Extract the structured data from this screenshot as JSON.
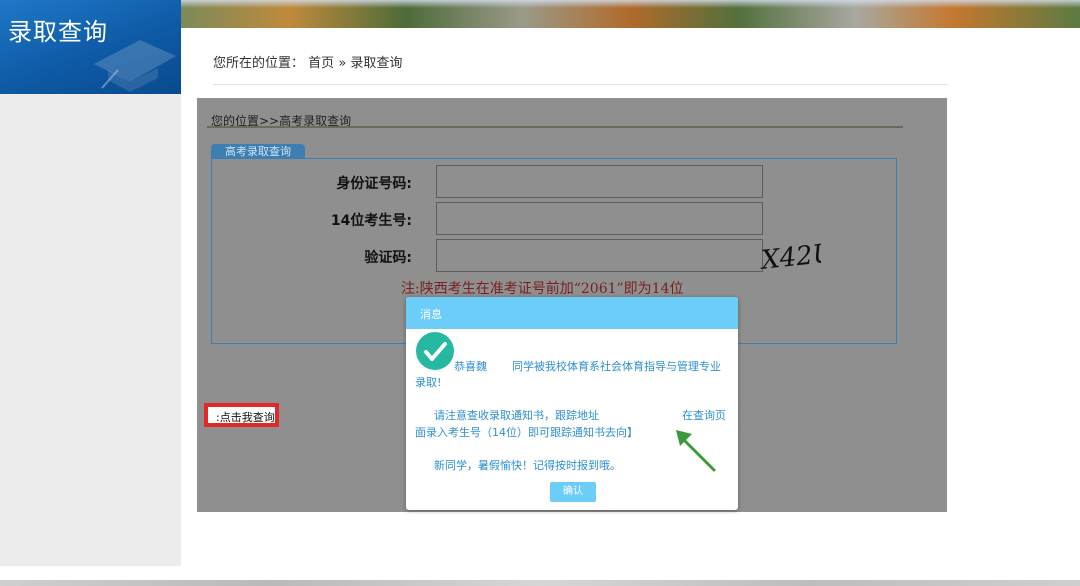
{
  "sidebar": {
    "title": "录取查询"
  },
  "location": {
    "prefix": "您所在的位置：",
    "home": "首页",
    "sep": " » ",
    "current": "录取查询"
  },
  "main": {
    "breadcrumb": "您的位置>>高考录取查询",
    "tab_label": "高考录取查询",
    "form": {
      "id_label": "身份证号码:",
      "exam_label": "14位考生号:",
      "captcha_label": "验证码:",
      "captcha_text": "X42U",
      "note": "注:陕西考生在准考证号前加“2061”即为14位"
    }
  },
  "dialog": {
    "title": "消息",
    "congrats_a": "恭喜魏",
    "congrats_b": "同学被我校体育系社会体育指导与管理专业",
    "congrats_c": "录取!",
    "notice_a": "请注意查收录取通知书，跟踪地址",
    "notice_link": ":点击我查询",
    "notice_b": "在查询页",
    "notice_c": "面录入考生号（14位）即可跟踪通知书去向】",
    "farewell": "新同学，暑假愉快！记得按时报到哦。",
    "ok_label": "确认"
  },
  "colors": {
    "dialog_header": "#6ccdf8",
    "highlight": "#e4282a",
    "arrow": "#3a9a3a",
    "check": "#26b8a0"
  }
}
